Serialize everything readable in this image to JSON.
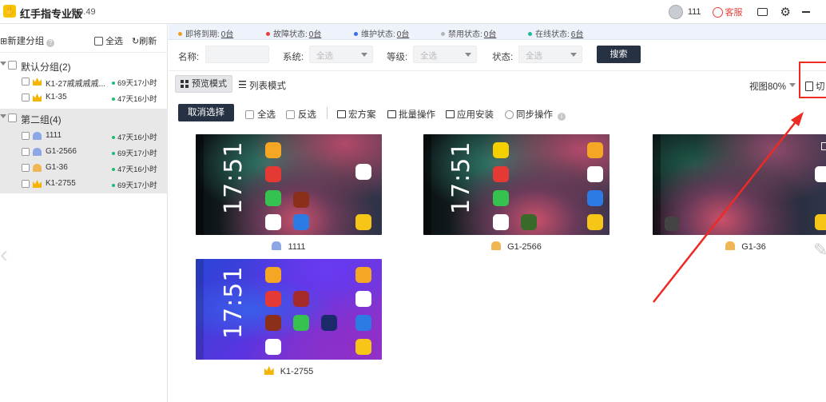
{
  "titlebar": {
    "app_title": "红手指专业版",
    "version": "9.0.49",
    "username": "111",
    "support_label": "客服"
  },
  "sidebar": {
    "new_group": "新建分组",
    "select_all": "全选",
    "refresh": "刷新",
    "groups": [
      {
        "name": "默认分组(2)",
        "devices": [
          {
            "name": "K1-27戚戚戚戚...",
            "time": "69天17小时",
            "icon": "crown-icon"
          },
          {
            "name": "K1-35",
            "time": "47天16小时",
            "icon": "crown-icon"
          }
        ]
      },
      {
        "name": "第二组(4)",
        "devices": [
          {
            "name": "1111",
            "time": "47天16小时",
            "icon": "android-icon"
          },
          {
            "name": "G1-2566",
            "time": "69天17小时",
            "icon": "android-icon"
          },
          {
            "name": "G1-36",
            "time": "47天16小时",
            "icon": "android-icon"
          },
          {
            "name": "K1-2755",
            "time": "69天17小时",
            "icon": "crown-icon"
          }
        ]
      }
    ]
  },
  "status": [
    {
      "label": "即将到期:",
      "count": "0台",
      "color": "#f0a020"
    },
    {
      "label": "故障状态:",
      "count": "0台",
      "color": "#e8403a"
    },
    {
      "label": "维护状态:",
      "count": "0台",
      "color": "#3a6de8"
    },
    {
      "label": "禁用状态:",
      "count": "0台",
      "color": "#b5b5b5"
    },
    {
      "label": "在线状态:",
      "count": "6台",
      "color": "#1fba9a"
    }
  ],
  "filters": {
    "name_label": "名称:",
    "system_label": "系统:",
    "system_value": "全选",
    "level_label": "等级:",
    "level_value": "全选",
    "state_label": "状态:",
    "state_value": "全选",
    "search_button": "搜索"
  },
  "view": {
    "preview_mode": "预览模式",
    "list_mode": "列表模式",
    "zoom": "视图80%",
    "switch_label": "切"
  },
  "actions": {
    "cancel_select": "取消选择",
    "select_all": "全选",
    "invert": "反选",
    "macro": "宏方案",
    "batch": "批量操作",
    "install": "应用安装",
    "sync": "同步操作"
  },
  "phones": [
    {
      "name": "1111",
      "time": "17:51"
    },
    {
      "name": "G1-2566",
      "time": "17:51"
    },
    {
      "name": "G1-36",
      "time": ""
    },
    {
      "name": "K1-2755",
      "time": "17:51"
    }
  ]
}
